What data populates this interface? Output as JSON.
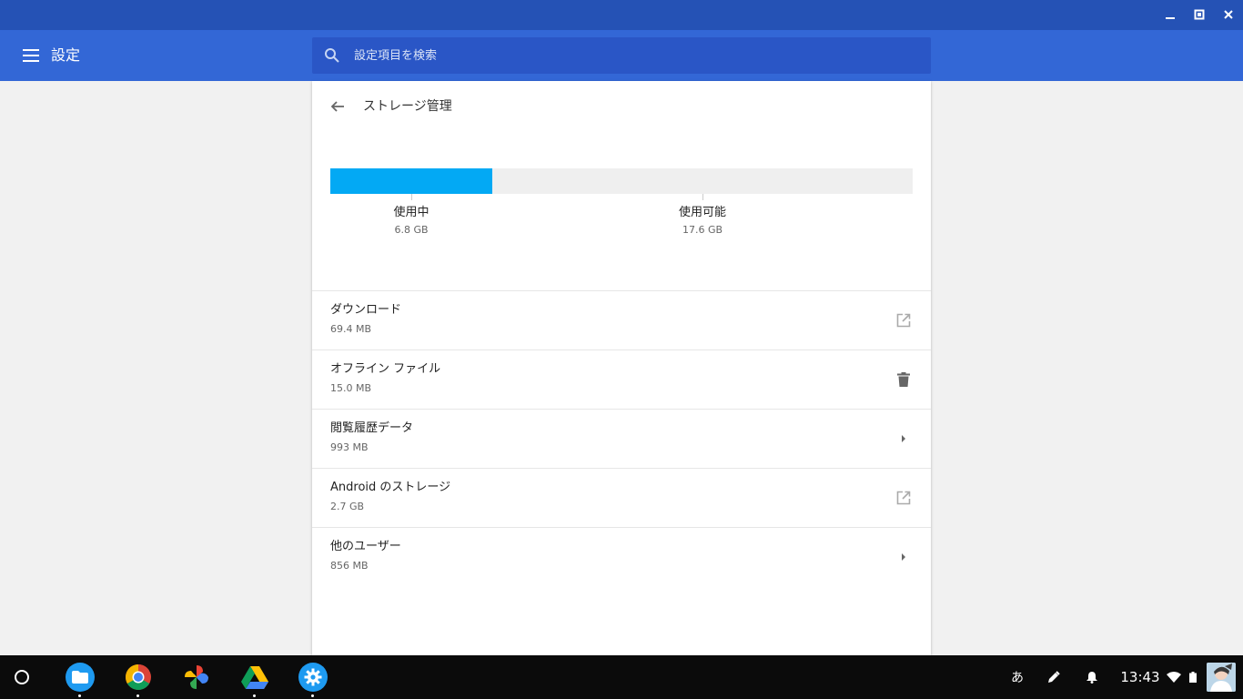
{
  "header": {
    "title": "設定",
    "search_placeholder": "設定項目を検索"
  },
  "page": {
    "title": "ストレージ管理"
  },
  "storage": {
    "used_fraction": 0.278,
    "used_label": "使用中",
    "used_value": "6.8 GB",
    "available_label": "使用可能",
    "available_value": "17.6 GB",
    "bar_color": "#03a9f4"
  },
  "items": [
    {
      "label": "ダウンロード",
      "value": "69.4 MB",
      "action_icon": "open-external-icon"
    },
    {
      "label": "オフライン ファイル",
      "value": "15.0 MB",
      "action_icon": "delete-icon"
    },
    {
      "label": "閲覧履歴データ",
      "value": "993 MB",
      "action_icon": "arrow-right-icon"
    },
    {
      "label": "Android のストレージ",
      "value": "2.7 GB",
      "action_icon": "open-external-icon"
    },
    {
      "label": "他のユーザー",
      "value": "856 MB",
      "action_icon": "arrow-right-icon"
    }
  ],
  "shelf": {
    "apps": [
      "files-app",
      "chrome-app",
      "photos-app",
      "drive-app",
      "settings-app"
    ],
    "ime": "あ",
    "time": "13:43"
  },
  "colors": {
    "titlebar": "#2552b5",
    "appbar": "#3367d6",
    "accent": "#03a9f4"
  }
}
